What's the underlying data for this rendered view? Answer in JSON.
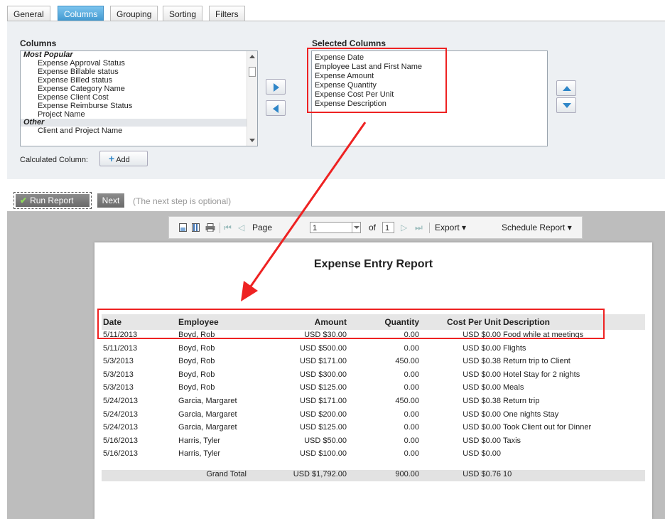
{
  "tabs": [
    "General",
    "Columns",
    "Grouping",
    "Sorting",
    "Filters"
  ],
  "columns_label": "Columns",
  "selected_label": "Selected Columns",
  "available": {
    "group1": "Most Popular",
    "items1": [
      "Expense Approval Status",
      "Expense Billable status",
      "Expense Billed status",
      "Expense Category Name",
      "Expense Client Cost",
      "Expense Reimburse Status",
      "Project Name"
    ],
    "group2": "Other",
    "items2": [
      "Client and Project Name"
    ]
  },
  "selected": [
    "Expense Date",
    "Employee Last and First Name",
    "Expense Amount",
    "Expense Quantity",
    "Expense Cost Per Unit",
    "Expense Description"
  ],
  "calc_label": "Calculated Column:",
  "add_label": "Add",
  "run_label": "Run Report",
  "next_label": "Next",
  "optional_text": "(The next step is optional)",
  "toolbar": {
    "page_label": "Page",
    "page_value": "1",
    "of_label": "of",
    "total_pages": "1",
    "export_label": "Export",
    "schedule_label": "Schedule Report"
  },
  "report": {
    "title": "Expense Entry Report",
    "headers": [
      "Date",
      "Employee",
      "Amount",
      "Quantity",
      "Cost Per Unit",
      "Description"
    ],
    "rows": [
      [
        "5/11/2013",
        "Boyd, Rob",
        "USD $30.00",
        "0.00",
        "USD $0.00",
        "Food while at meetings"
      ],
      [
        "5/11/2013",
        "Boyd, Rob",
        "USD $500.00",
        "0.00",
        "USD $0.00",
        "Flights"
      ],
      [
        "5/3/2013",
        "Boyd, Rob",
        "USD $171.00",
        "450.00",
        "USD $0.38",
        "Return trip to Client"
      ],
      [
        "5/3/2013",
        "Boyd, Rob",
        "USD $300.00",
        "0.00",
        "USD $0.00",
        "Hotel Stay for 2 nights"
      ],
      [
        "5/3/2013",
        "Boyd, Rob",
        "USD $125.00",
        "0.00",
        "USD $0.00",
        "Meals"
      ],
      [
        "5/24/2013",
        "Garcia, Margaret",
        "USD $171.00",
        "450.00",
        "USD $0.38",
        "Return trip"
      ],
      [
        "5/24/2013",
        "Garcia, Margaret",
        "USD $200.00",
        "0.00",
        "USD $0.00",
        "One nights Stay"
      ],
      [
        "5/24/2013",
        "Garcia, Margaret",
        "USD $125.00",
        "0.00",
        "USD $0.00",
        "Took Client out for Dinner"
      ],
      [
        "5/16/2013",
        "Harris, Tyler",
        "USD $50.00",
        "0.00",
        "USD $0.00",
        "Taxis"
      ],
      [
        "5/16/2013",
        "Harris, Tyler",
        "USD $100.00",
        "0.00",
        "USD $0.00",
        ""
      ]
    ],
    "grand_total": {
      "label": "Grand Total",
      "amount": "USD $1,792.00",
      "quantity": "900.00",
      "cpu": "USD $0.76",
      "desc": "10"
    }
  }
}
